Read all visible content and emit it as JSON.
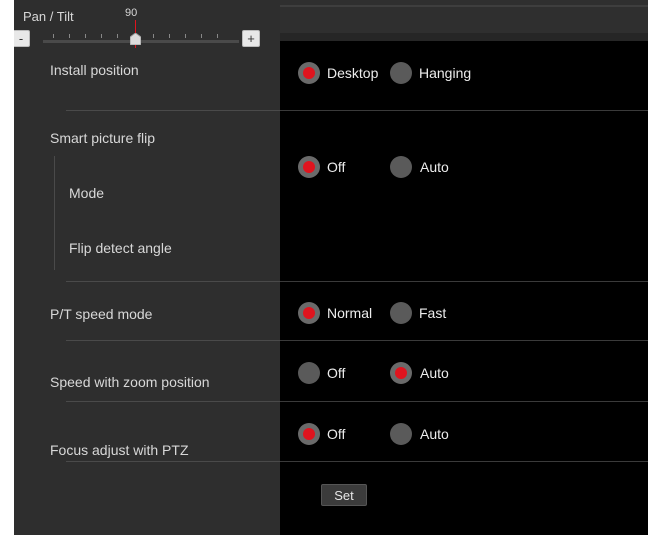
{
  "pan_tilt": {
    "title": "Pan / Tilt",
    "value": "90",
    "minus": "-",
    "plus": "+"
  },
  "settings": {
    "install_position": {
      "label": "Install position",
      "options": [
        "Desktop",
        "Hanging"
      ],
      "selected": "Desktop"
    },
    "smart_picture_flip": {
      "label": "Smart picture flip",
      "options": [
        "Off",
        "Auto"
      ],
      "selected": "Off",
      "sub": {
        "mode": "Mode",
        "flip_detect_angle": "Flip detect angle"
      }
    },
    "pt_speed_mode": {
      "label": "P/T speed mode",
      "options": [
        "Normal",
        "Fast"
      ],
      "selected": "Normal"
    },
    "speed_with_zoom": {
      "label": "Speed with zoom position",
      "options": [
        "Off",
        "Auto"
      ],
      "selected": "Auto"
    },
    "focus_adjust_ptz": {
      "label": "Focus adjust with PTZ",
      "options": [
        "Off",
        "Auto"
      ],
      "selected": "Off"
    }
  },
  "set_button": "Set",
  "colors": {
    "accent": "#e0141e",
    "panel_left": "#2e2e2e",
    "panel_right": "#000000"
  }
}
